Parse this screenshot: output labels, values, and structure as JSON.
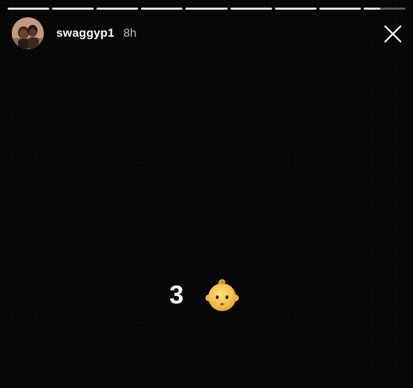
{
  "story": {
    "progress": {
      "segment_count": 9,
      "segments": [
        1,
        1,
        1,
        1,
        1,
        1,
        1,
        1,
        0.4
      ]
    },
    "header": {
      "username": "swaggyp1",
      "time": "8h"
    },
    "content": {
      "count": "3",
      "emoji": "baby-face-emoji"
    },
    "icons": {
      "close": "close-icon",
      "avatar": "profile-photo"
    }
  }
}
